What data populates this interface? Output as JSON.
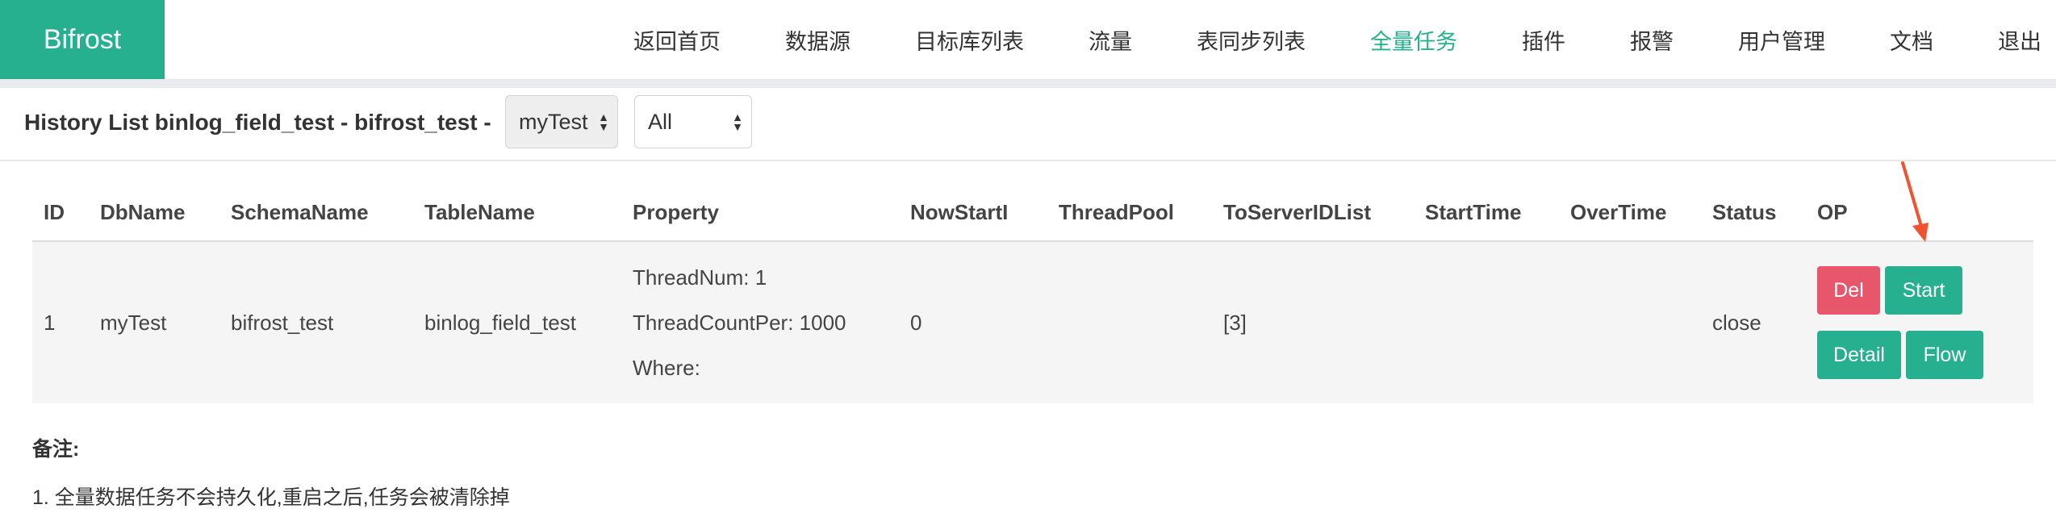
{
  "brand": "Bifrost",
  "nav": [
    "返回首页",
    "数据源",
    "目标库列表",
    "流量",
    "表同步列表",
    "全量任务",
    "插件",
    "报警",
    "用户管理",
    "文档",
    "退出"
  ],
  "nav_active": "全量任务",
  "page_title": "History List binlog_field_test - bifrost_test -",
  "filters": {
    "db_select": "myTest",
    "status_select": "All"
  },
  "table": {
    "headers": [
      "ID",
      "DbName",
      "SchemaName",
      "TableName",
      "Property",
      "NowStartI",
      "ThreadPool",
      "ToServerIDList",
      "StartTime",
      "OverTime",
      "Status",
      "OP"
    ],
    "rows": [
      {
        "id": "1",
        "db_name": "myTest",
        "schema_name": "bifrost_test",
        "table_name": "binlog_field_test",
        "property": [
          "ThreadNum: 1",
          "ThreadCountPer: 1000",
          "Where:"
        ],
        "now_start_i": "0",
        "thread_pool": "",
        "to_server_id_list": "[3]",
        "start_time": "",
        "over_time": "",
        "status": "close",
        "op": {
          "del": "Del",
          "start": "Start",
          "detail": "Detail",
          "flow": "Flow"
        }
      }
    ]
  },
  "notes": {
    "title": "备注:",
    "items": [
      "1. 全量数据任务不会持久化,重启之后,任务会被清除掉"
    ]
  },
  "colors": {
    "brand": "#26b08f",
    "danger": "#e8566c",
    "annotation_arrow": "#f0532f"
  }
}
